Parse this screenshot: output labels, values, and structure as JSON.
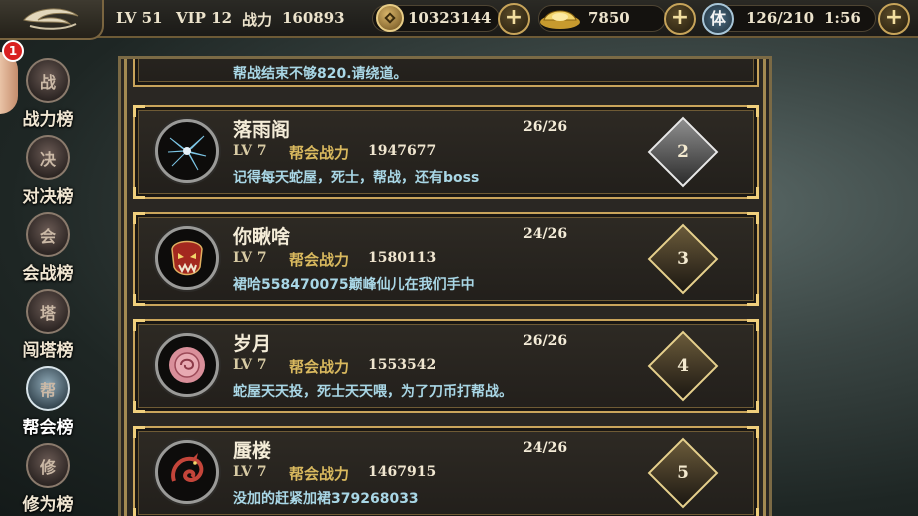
{
  "topbar": {
    "level": "LV 51",
    "vip": "VIP 12",
    "power_label": "战力",
    "power_value": "160893",
    "coins": "10323144",
    "ingots": "7850",
    "stamina_label": "体",
    "stamina": "126/210",
    "timer": "1:56",
    "plus": "+"
  },
  "sidebar": {
    "notification_count": "1",
    "items": [
      {
        "label": "战力榜",
        "glyph": "战"
      },
      {
        "label": "对决榜",
        "glyph": "决"
      },
      {
        "label": "会战榜",
        "glyph": "会"
      },
      {
        "label": "闯塔榜",
        "glyph": "塔"
      },
      {
        "label": "帮会榜",
        "glyph": "帮"
      },
      {
        "label": "修为榜",
        "glyph": "修"
      }
    ]
  },
  "list": {
    "partial_notice": "帮战结束不够820.请绕道。",
    "guilds": [
      {
        "rank": "2",
        "name": "落雨阁",
        "members": "26/26",
        "level": "LV 7",
        "power_label": "帮会战力",
        "power": "1947677",
        "notice": "记得每天蛇屋，死士，帮战，还有boss"
      },
      {
        "rank": "3",
        "name": "你瞅啥",
        "members": "24/26",
        "level": "LV 7",
        "power_label": "帮会战力",
        "power": "1580113",
        "notice": "裙哈558470075巅峰仙儿在我们手中"
      },
      {
        "rank": "4",
        "name": "岁月",
        "members": "26/26",
        "level": "LV 7",
        "power_label": "帮会战力",
        "power": "1553542",
        "notice": "蛇屋天天投，死士天天喂，为了刀币打帮战。"
      },
      {
        "rank": "5",
        "name": "蜃楼",
        "members": "24/26",
        "level": "LV 7",
        "power_label": "帮会战力",
        "power": "1467915",
        "notice": "没加的赶紧加裙379268033"
      }
    ]
  },
  "colors": {
    "gold_border": "#c9a45b",
    "notice_text": "#a9d7e6",
    "power_label": "#d9b95e"
  }
}
